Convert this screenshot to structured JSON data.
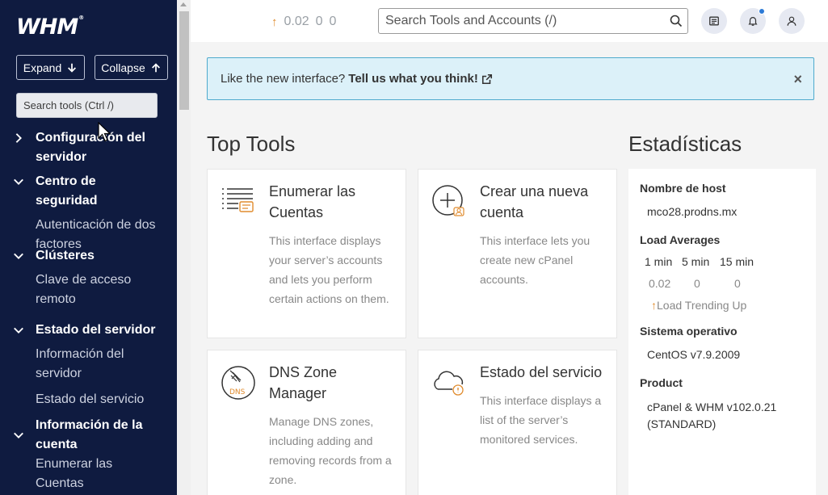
{
  "sidebar": {
    "logo": "WHM",
    "logo_mark": "®",
    "expand_label": "Expand",
    "collapse_label": "Collapse",
    "search_placeholder": "Search tools (Ctrl /)",
    "sections": [
      {
        "title": "Configuración del servidor",
        "expanded": false,
        "items": []
      },
      {
        "title": "Centro de seguridad",
        "expanded": true,
        "items": [
          "Autenticación de dos factores"
        ]
      },
      {
        "title": "Clústeres",
        "expanded": true,
        "items": [
          "Clave de acceso remoto"
        ]
      },
      {
        "title": "Estado del servidor",
        "expanded": true,
        "items": [
          "Información del servidor",
          "Estado del servicio"
        ]
      },
      {
        "title": "Información de la cuenta",
        "expanded": true,
        "items": [
          "Enumerar las Cuentas"
        ]
      }
    ]
  },
  "topbar": {
    "load": [
      "0.02",
      "0",
      "0"
    ],
    "search_placeholder": "Search Tools and Accounts (/)"
  },
  "notice": {
    "text": "Like the new interface?",
    "link": "Tell us what you think!",
    "close": "×"
  },
  "top_tools": {
    "title": "Top Tools",
    "cards": [
      {
        "title": "Enumerar las Cuentas",
        "desc": "This interface displays your server’s accounts and lets you perform certain actions on them.",
        "icon": "list-accounts-icon"
      },
      {
        "title": "Crear una nueva cuenta",
        "desc": "This interface lets you create new cPanel accounts.",
        "icon": "create-account-icon"
      },
      {
        "title": "DNS Zone Manager",
        "desc": "Manage DNS zones, including adding and removing records from a zone.",
        "icon": "dns-zone-icon",
        "icon_text": "DNS"
      },
      {
        "title": "Estado del servicio",
        "desc": "This interface displays a list of the server’s monitored services.",
        "icon": "service-status-icon"
      }
    ]
  },
  "stats": {
    "title": "Estadísticas",
    "hostname_label": "Nombre de host",
    "hostname": "mco28.prodns.mx",
    "load_label": "Load Averages",
    "load_headers": [
      "1 min",
      "5 min",
      "15 min"
    ],
    "load_values": [
      "0.02",
      "0",
      "0"
    ],
    "trend": "Load Trending Up",
    "os_label": "Sistema operativo",
    "os": "CentOS v7.9.2009",
    "product_label": "Product",
    "product": "cPanel & WHM v102.0.21 (STANDARD)"
  },
  "colors": {
    "sidebar_bg": "#0f1b40",
    "notice_bg": "#dcf1f9",
    "notice_border": "#4eaacd",
    "trend_arrow": "#e08b2d",
    "bell_dot": "#2c7ad6"
  }
}
